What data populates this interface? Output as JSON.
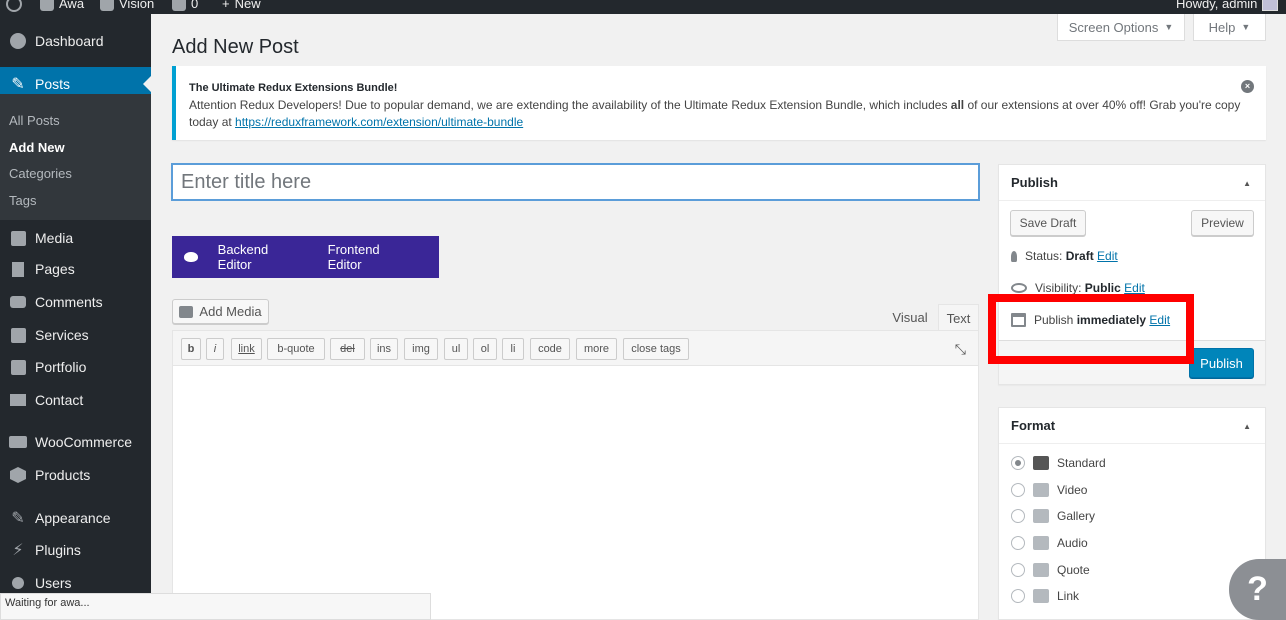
{
  "adminbar": {
    "site_name": "Awa",
    "vision": "Vision",
    "comments_count": "0",
    "new_label": "New",
    "howdy": "Howdy, admin"
  },
  "sidebar": {
    "items": [
      {
        "label": "Dashboard",
        "icon": "dashboard-icon"
      },
      {
        "label": "Posts",
        "icon": "pin-icon"
      },
      {
        "label": "Media",
        "icon": "media-icon"
      },
      {
        "label": "Pages",
        "icon": "pages-icon"
      },
      {
        "label": "Comments",
        "icon": "comments-icon"
      },
      {
        "label": "Services",
        "icon": "services-icon"
      },
      {
        "label": "Portfolio",
        "icon": "portfolio-icon"
      },
      {
        "label": "Contact",
        "icon": "envelope-icon"
      },
      {
        "label": "WooCommerce",
        "icon": "woocommerce-icon"
      },
      {
        "label": "Products",
        "icon": "products-icon"
      },
      {
        "label": "Appearance",
        "icon": "appearance-icon"
      },
      {
        "label": "Plugins",
        "icon": "plugins-icon"
      },
      {
        "label": "Users",
        "icon": "users-icon"
      }
    ],
    "submenu": [
      "All Posts",
      "Add New",
      "Categories",
      "Tags"
    ],
    "active_color": "#0073aa"
  },
  "header": {
    "page_title": "Add New Post",
    "screen_options": "Screen Options",
    "help": "Help"
  },
  "notice": {
    "title": "The Ultimate Redux Extensions Bundle!",
    "body_1": "Attention Redux Developers! Due to popular demand, we are extending the availability of the Ultimate Redux Extension Bundle, which includes ",
    "body_bold": "all",
    "body_2": " of our extensions at over 40% off! Grab you're copy today at ",
    "link": "https://reduxframework.com/extension/ultimate-bundle"
  },
  "editor": {
    "title_placeholder": "Enter title here",
    "backend_editor": "Backend Editor",
    "frontend_editor": "Frontend Editor",
    "add_media": "Add Media",
    "tab_visual": "Visual",
    "tab_text": "Text",
    "quicktags": [
      "b",
      "i",
      "link",
      "b-quote",
      "del",
      "ins",
      "img",
      "ul",
      "ol",
      "li",
      "code",
      "more",
      "close tags"
    ]
  },
  "publish_box": {
    "title": "Publish",
    "save_draft": "Save Draft",
    "preview": "Preview",
    "status_label": "Status: ",
    "status_value": "Draft",
    "visibility_label": "Visibility: ",
    "visibility_value": "Public",
    "publish_label": "Publish ",
    "publish_value": "immediately",
    "edit": "Edit",
    "publish_button": "Publish"
  },
  "format_box": {
    "title": "Format",
    "options": [
      "Standard",
      "Video",
      "Gallery",
      "Audio",
      "Quote",
      "Link"
    ],
    "selected": "Standard"
  },
  "status_bar": "Waiting for awa...",
  "help_bubble": "?",
  "colors": {
    "highlight": "#ff0000",
    "vc_purple": "#3a2697",
    "publish_blue": "#0085ba"
  }
}
